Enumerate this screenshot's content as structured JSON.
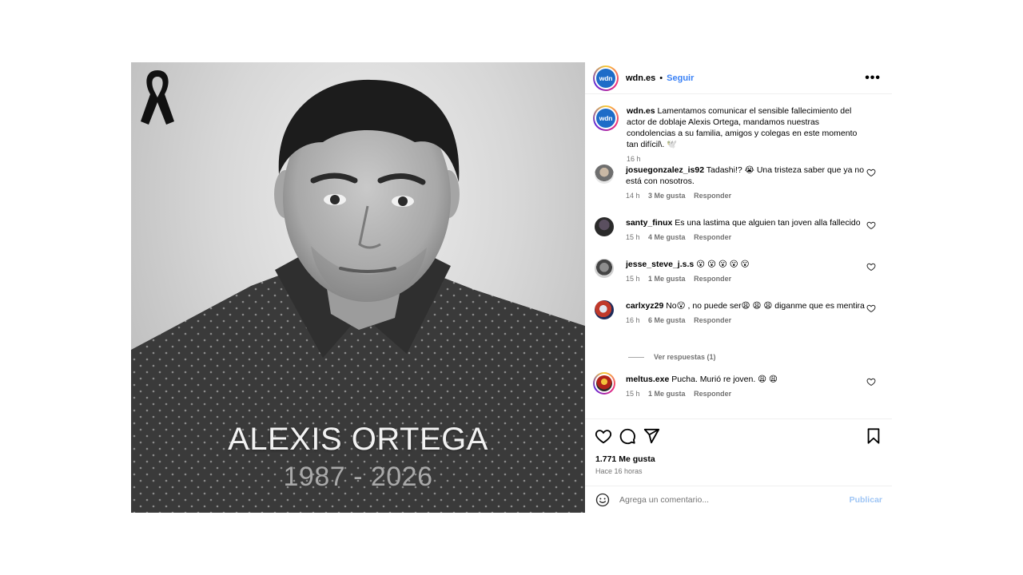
{
  "photo": {
    "name": "ALEXIS ORTEGA",
    "years": "1987 - 2026"
  },
  "header": {
    "avatar_text": "wdn",
    "username": "wdn.es",
    "separator": "•",
    "follow_label": "Seguir",
    "more_label": "•••"
  },
  "caption": {
    "username": "wdn.es",
    "text": "Lamentamos comunicar el sensible fallecimiento del actor de doblaje Alexis Ortega, mandamos nuestras condolencias a su familia, amigos y colegas en este momento tan difícil\\. 🕊️",
    "time": "16 h"
  },
  "comments": [
    {
      "username": "josuegonzalez_is92",
      "text": "Tadashi!? 😭 Una tristeza saber que ya no está con nosotros.",
      "time": "14 h",
      "likes": "3 Me gusta",
      "reply": "Responder"
    },
    {
      "username": "santy_finux",
      "text": "Es una lastima que alguien tan joven alla fallecido",
      "time": "15 h",
      "likes": "4 Me gusta",
      "reply": "Responder"
    },
    {
      "username": "jesse_steve_j.s.s",
      "text": "😮 😮 😮 😮 😮",
      "time": "15 h",
      "likes": "1 Me gusta",
      "reply": "Responder"
    },
    {
      "username": "carlxyz29",
      "text": "No😮 , no puede ser😩 😩 😩 diganme que es mentira",
      "time": "16 h",
      "likes": "6 Me gusta",
      "reply": "Responder"
    },
    {
      "username": "meltus.exe",
      "text": "Pucha. Murió re joven. 😩 😩",
      "time": "15 h",
      "likes": "1 Me gusta",
      "reply": "Responder"
    }
  ],
  "view_replies": "Ver respuestas (1)",
  "actions": {
    "likes": "1.771 Me gusta",
    "time_ago": "Hace 16 horas"
  },
  "add_comment": {
    "placeholder": "Agrega un comentario...",
    "publish": "Publicar"
  },
  "colors": {
    "follow": "#3b82f6",
    "publish_disabled": "#9ec5f5",
    "wdn_blue": "#1e6cc8",
    "muted": "#737373"
  }
}
